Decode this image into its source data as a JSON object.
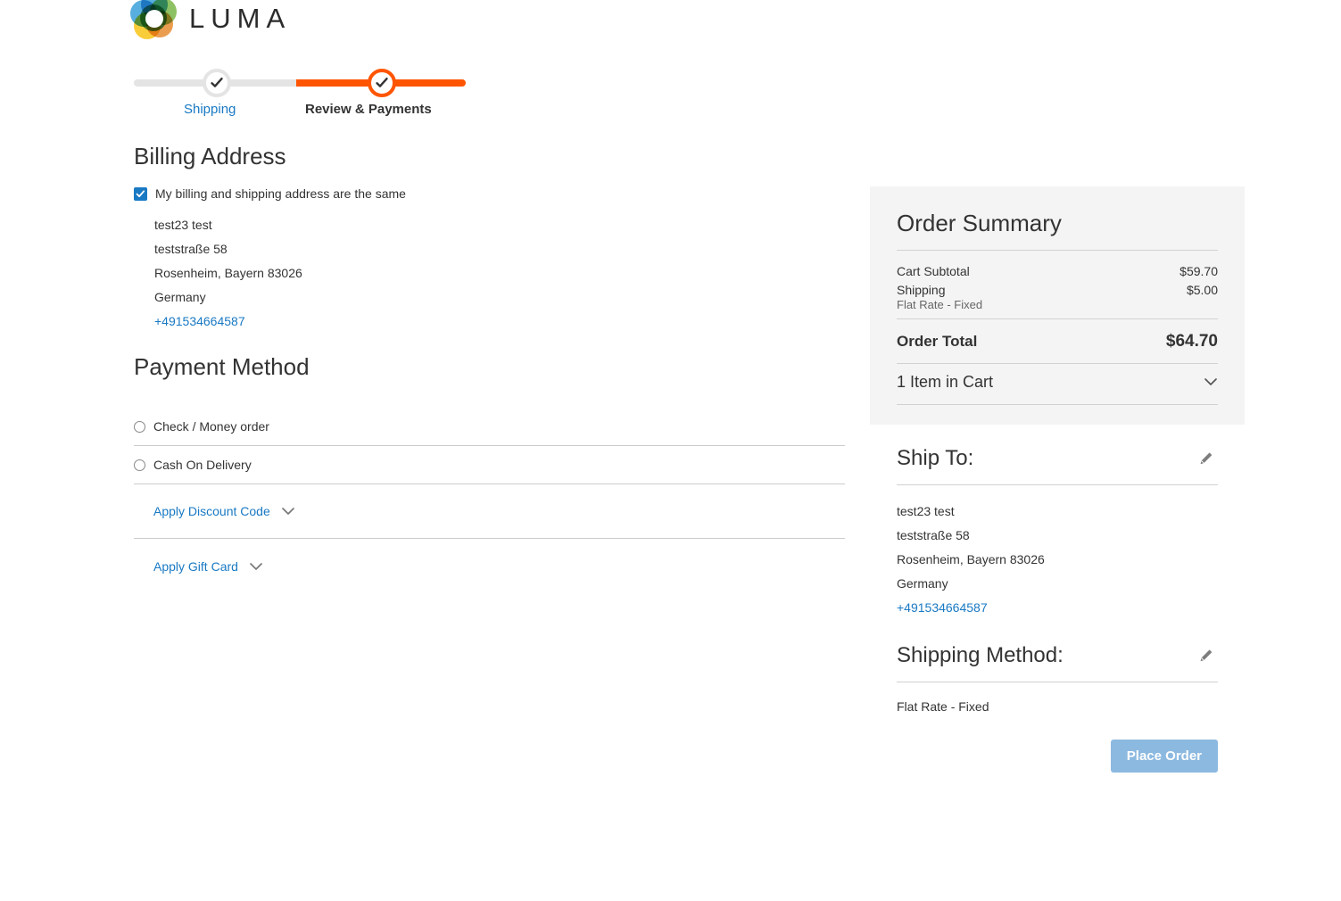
{
  "brand": {
    "name": "LUMA",
    "logo_icon": "luma-rings-logo",
    "ring_colors": [
      "#3aa0d9",
      "#7ab648",
      "#f8c517",
      "#e88c30",
      "#8e5a3a",
      "#2e8b57"
    ]
  },
  "progress": {
    "steps": [
      {
        "key": "shipping",
        "label": "Shipping",
        "state": "complete",
        "icon": "check-icon"
      },
      {
        "key": "review",
        "label": "Review & Payments",
        "state": "active",
        "icon": "check-icon"
      }
    ],
    "track_color": "#e4e4e4",
    "fill_color": "#ff5501",
    "link_color": "#1979c3"
  },
  "billing": {
    "title": "Billing Address",
    "same_as_shipping": {
      "label": "My billing and shipping address are the same",
      "checked": true,
      "color": "#1979c3"
    },
    "address": {
      "name": "test23 test",
      "street": "teststraße 58",
      "city_region_postcode": "Rosenheim, Bayern 83026",
      "country": "Germany",
      "telephone": "+491534664587"
    }
  },
  "payment": {
    "title": "Payment Method",
    "methods": [
      {
        "label": "Check / Money order",
        "selected": false
      },
      {
        "label": "Cash On Delivery",
        "selected": false
      }
    ],
    "accordions": [
      {
        "label": "Apply Discount Code",
        "icon": "chevron-down-icon",
        "expanded": false
      },
      {
        "label": "Apply Gift Card",
        "icon": "chevron-down-icon",
        "expanded": false
      }
    ]
  },
  "order_summary": {
    "title": "Order Summary",
    "rows": [
      {
        "label": "Cart Subtotal",
        "value": "$59.70",
        "sub": null
      },
      {
        "label": "Shipping",
        "value": "$5.00",
        "sub": "Flat Rate - Fixed"
      }
    ],
    "total": {
      "label": "Order Total",
      "value": "$64.70"
    },
    "items_toggle": {
      "label": "1 Item in Cart",
      "icon": "chevron-down-icon"
    },
    "background": "#f4f4f4"
  },
  "ship_to": {
    "title": "Ship To:",
    "edit_icon": "pencil-edit-icon",
    "address": {
      "name": "test23 test",
      "street": "teststraße 58",
      "city_region_postcode": "Rosenheim, Bayern 83026",
      "country": "Germany",
      "telephone": "+491534664587"
    }
  },
  "shipping_method": {
    "title": "Shipping Method:",
    "edit_icon": "pencil-edit-icon",
    "value": "Flat Rate - Fixed"
  },
  "actions": {
    "place_order": {
      "label": "Place Order",
      "color": "#8cb9e0",
      "disabled": true
    }
  }
}
